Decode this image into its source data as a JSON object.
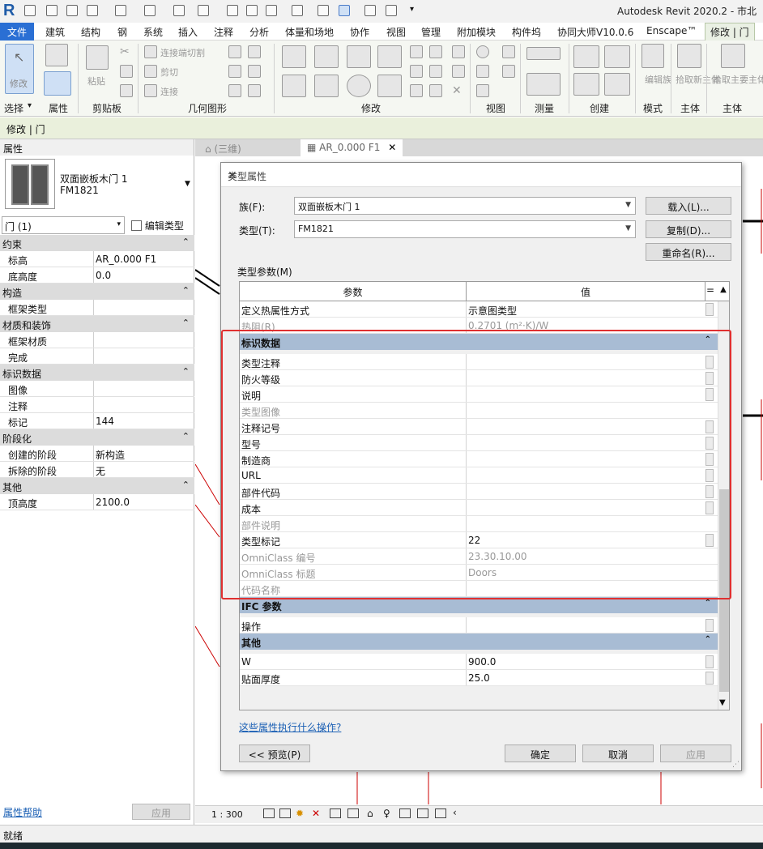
{
  "window": {
    "app_title": "Autodesk Revit 2020.2 - 市北",
    "app_logo": "R"
  },
  "menubar": {
    "items": [
      "文件",
      "建筑",
      "结构",
      "钢",
      "系统",
      "插入",
      "注释",
      "分析",
      "体量和场地",
      "协作",
      "视图",
      "管理",
      "附加模块",
      "构件坞",
      "协同大师V10.0.6",
      "Enscape™",
      "修改 | 门"
    ]
  },
  "ribbon": {
    "modify_btn": "修改",
    "paste_btn": "粘贴",
    "cut_geom": "连接端切割",
    "cut": "剪切",
    "join": "连接",
    "edit_family": "编辑族",
    "pick_host": "拾取新主体",
    "pick_host2": "拾取主要主体",
    "panels": [
      "选择",
      "属性",
      "剪贴板",
      "几何图形",
      "修改",
      "视图",
      "测量",
      "创建",
      "模式",
      "主体",
      "主体"
    ]
  },
  "context": {
    "label": "修改 | 门"
  },
  "props": {
    "header": "属性",
    "family_name": "双面嵌板木门 1",
    "type_name": "FM1821",
    "selector": "门 (1)",
    "edit_type": "编辑类型",
    "rows": [
      {
        "kind": "cat",
        "label": "约束"
      },
      {
        "kind": "row",
        "k": "标高",
        "v": "AR_0.000 F1"
      },
      {
        "kind": "row",
        "k": "底高度",
        "v": "0.0"
      },
      {
        "kind": "cat",
        "label": "构造"
      },
      {
        "kind": "row",
        "k": "框架类型",
        "v": ""
      },
      {
        "kind": "cat",
        "label": "材质和装饰"
      },
      {
        "kind": "row",
        "k": "框架材质",
        "v": ""
      },
      {
        "kind": "row",
        "k": "完成",
        "v": ""
      },
      {
        "kind": "cat",
        "label": "标识数据"
      },
      {
        "kind": "row",
        "k": "图像",
        "v": ""
      },
      {
        "kind": "row",
        "k": "注释",
        "v": ""
      },
      {
        "kind": "row",
        "k": "标记",
        "v": "144"
      },
      {
        "kind": "cat",
        "label": "阶段化"
      },
      {
        "kind": "row",
        "k": "创建的阶段",
        "v": "新构造"
      },
      {
        "kind": "row",
        "k": "拆除的阶段",
        "v": "无"
      },
      {
        "kind": "cat",
        "label": "其他"
      },
      {
        "kind": "row",
        "k": "顶高度",
        "v": "2100.0"
      }
    ],
    "help_link": "属性帮助",
    "apply": "应用"
  },
  "view_tabs": {
    "tab1": "(三维)",
    "tab2": "AR_0.000 F1"
  },
  "dialog": {
    "title": "类型属性",
    "family_label": "族(F):",
    "family_value": "双面嵌板木门 1",
    "type_label": "类型(T):",
    "type_value": "FM1821",
    "load_btn": "载入(L)...",
    "copy_btn": "复制(D)...",
    "rename_btn": "重命名(R)...",
    "params_label": "类型参数(M)",
    "col_param": "参数",
    "col_value": "值",
    "col_eq": "=",
    "rows": [
      {
        "kind": "row",
        "k": "定义热属性方式",
        "v": "示意图类型",
        "ro": false
      },
      {
        "kind": "row",
        "k": "热阻(R)",
        "v": "0.2701 (m²·K)/W",
        "ro": true
      },
      {
        "kind": "cat",
        "label": "标识数据"
      },
      {
        "kind": "row",
        "k": "类型注释",
        "v": "",
        "ro": false
      },
      {
        "kind": "row",
        "k": "防火等级",
        "v": "",
        "ro": false
      },
      {
        "kind": "row",
        "k": "说明",
        "v": "",
        "ro": false
      },
      {
        "kind": "row",
        "k": "类型图像",
        "v": "",
        "ro": true
      },
      {
        "kind": "row",
        "k": "注释记号",
        "v": "",
        "ro": false
      },
      {
        "kind": "row",
        "k": "型号",
        "v": "",
        "ro": false
      },
      {
        "kind": "row",
        "k": "制造商",
        "v": "",
        "ro": false
      },
      {
        "kind": "row",
        "k": "URL",
        "v": "",
        "ro": false
      },
      {
        "kind": "row",
        "k": "部件代码",
        "v": "",
        "ro": false
      },
      {
        "kind": "row",
        "k": "成本",
        "v": "",
        "ro": false
      },
      {
        "kind": "row",
        "k": "部件说明",
        "v": "",
        "ro": true
      },
      {
        "kind": "row",
        "k": "类型标记",
        "v": "22",
        "ro": false
      },
      {
        "kind": "row",
        "k": "OmniClass 编号",
        "v": "23.30.10.00",
        "ro": true
      },
      {
        "kind": "row",
        "k": "OmniClass 标题",
        "v": "Doors",
        "ro": true
      },
      {
        "kind": "row",
        "k": "代码名称",
        "v": "",
        "ro": true
      },
      {
        "kind": "cat",
        "label": "IFC 参数"
      },
      {
        "kind": "row",
        "k": "操作",
        "v": "",
        "ro": false
      },
      {
        "kind": "cat",
        "label": "其他"
      },
      {
        "kind": "row",
        "k": "W",
        "v": "900.0",
        "ro": false
      },
      {
        "kind": "row",
        "k": "贴面厚度",
        "v": "25.0",
        "ro": false
      }
    ],
    "help_link": "这些属性执行什么操作?",
    "preview_btn": "<< 预览(P)",
    "ok_btn": "确定",
    "cancel_btn": "取消",
    "apply_btn": "应用"
  },
  "viewbar": {
    "scale": "1 : 300"
  },
  "statusbar": {
    "text": "就绪"
  },
  "colors": {
    "highlight": "#e03030",
    "category_bg": "#a8bcd4",
    "file_tab": "#2a6fd4"
  }
}
